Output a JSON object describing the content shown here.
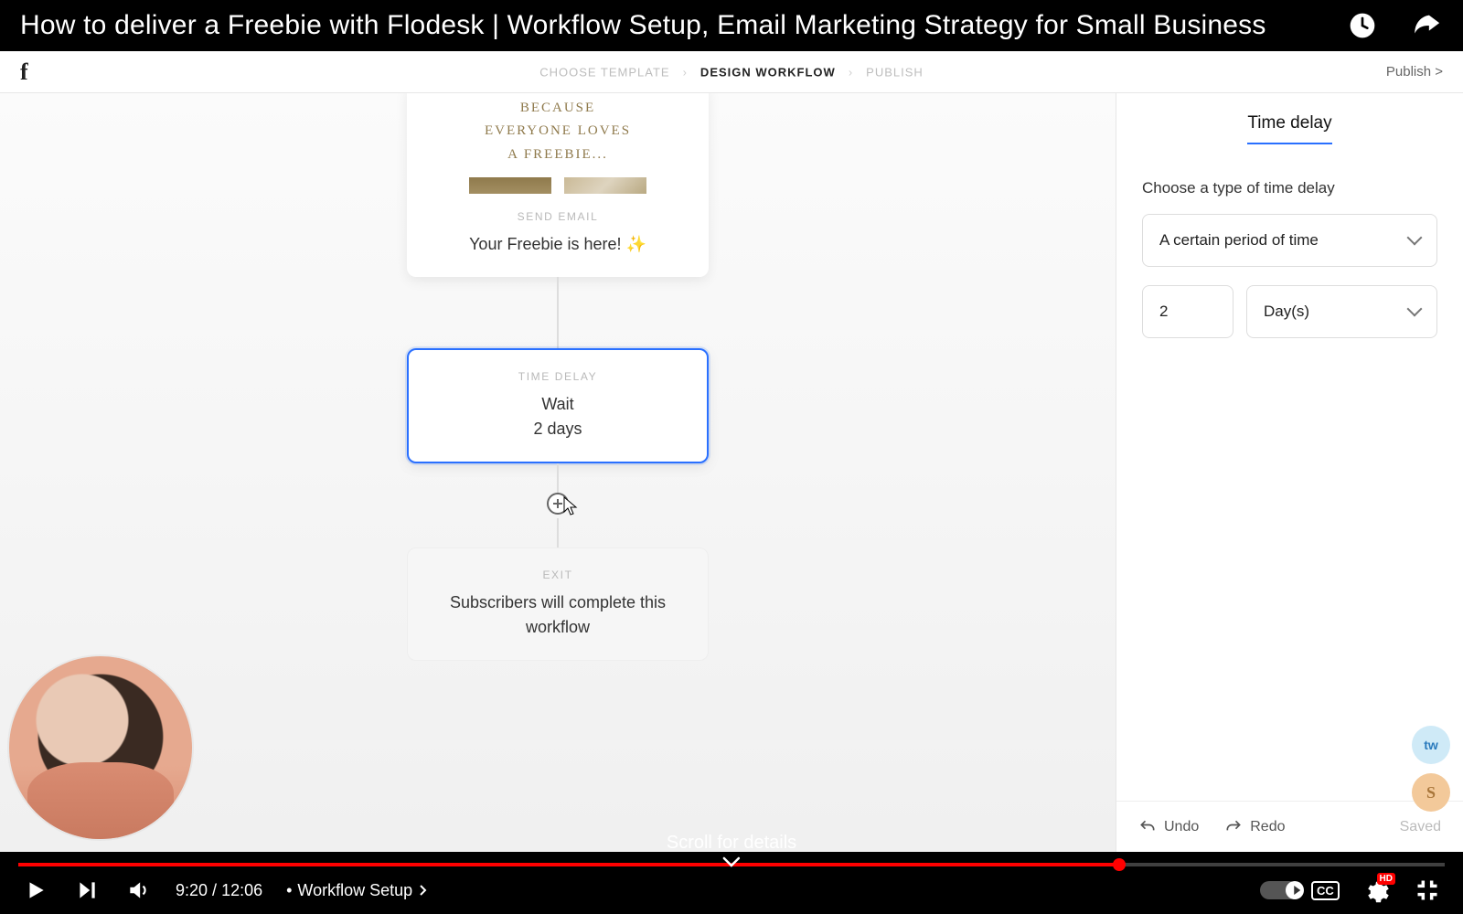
{
  "yt": {
    "title": "How to deliver a Freebie with Flodesk | Workflow Setup, Email Marketing Strategy for Small Business",
    "time_current": "9:20",
    "time_total": "12:06",
    "chapter": "Workflow Setup",
    "scroll_hint": "Scroll for details",
    "progress_pct": 77.2,
    "cc_label": "CC",
    "hd_label": "HD"
  },
  "fd": {
    "logo": "f",
    "breadcrumbs": {
      "a": "CHOOSE TEMPLATE",
      "b": "DESIGN WORKFLOW",
      "c": "PUBLISH"
    },
    "publish": "Publish >",
    "email_card": {
      "preview_line1": "BECAUSE",
      "preview_line2": "EVERYONE LOVES",
      "preview_line3": "A FREEBIE...",
      "cap": "SEND EMAIL",
      "subject": "Your Freebie is here! ✨"
    },
    "delay_card": {
      "cap": "TIME DELAY",
      "l1": "Wait",
      "l2": "2 days"
    },
    "exit_card": {
      "cap": "EXIT",
      "body": "Subscribers will complete this workflow"
    },
    "side": {
      "tab": "Time delay",
      "label": "Choose a type of time delay",
      "type_value": "A certain period of time",
      "amount": "2",
      "unit": "Day(s)",
      "undo": "Undo",
      "redo": "Redo",
      "saved": "Saved"
    },
    "ext": {
      "tw": "tw",
      "s": "S"
    }
  }
}
